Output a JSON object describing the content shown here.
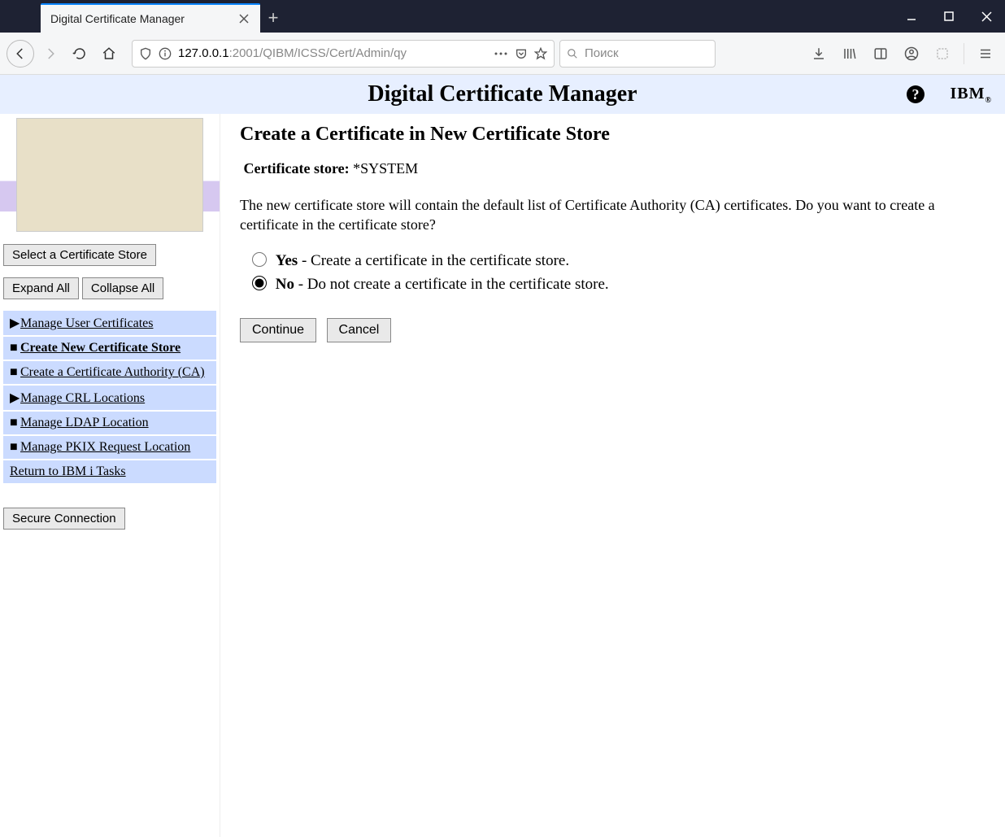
{
  "browser": {
    "tab_title": "Digital Certificate Manager",
    "url_host": "127.0.0.1",
    "url_path": ":2001/QIBM/ICSS/Cert/Admin/qy",
    "search_placeholder": "Поиск"
  },
  "header": {
    "title": "Digital Certificate Manager",
    "logo_text": "IBM"
  },
  "sidebar": {
    "select_store": "Select a Certificate Store",
    "expand_all": "Expand All",
    "collapse_all": "Collapse All",
    "items": [
      {
        "label": "Manage User Certificates",
        "marker": "▶",
        "bold": false
      },
      {
        "label": "Create New Certificate Store",
        "marker": "■",
        "bold": true
      },
      {
        "label": "Create a Certificate Authority (CA)",
        "marker": "■",
        "bold": false
      },
      {
        "label": "Manage CRL Locations",
        "marker": "▶",
        "bold": false
      },
      {
        "label": "Manage LDAP Location",
        "marker": "■",
        "bold": false
      },
      {
        "label": "Manage PKIX Request Location",
        "marker": "■",
        "bold": false
      },
      {
        "label": "Return to IBM i Tasks",
        "marker": "",
        "bold": false
      }
    ],
    "secure_connection": "Secure Connection"
  },
  "main": {
    "heading": "Create a Certificate in New Certificate Store",
    "store_label": "Certificate store:",
    "store_value": "*SYSTEM",
    "description": "The new certificate store will contain the default list of Certificate Authority (CA) certificates. Do you want to create a certificate in the certificate store?",
    "radio_yes_bold": "Yes",
    "radio_yes_rest": " - Create a certificate in the certificate store.",
    "radio_no_bold": "No",
    "radio_no_rest": " - Do not create a certificate in the certificate store.",
    "selected": "no",
    "continue": "Continue",
    "cancel": "Cancel"
  }
}
